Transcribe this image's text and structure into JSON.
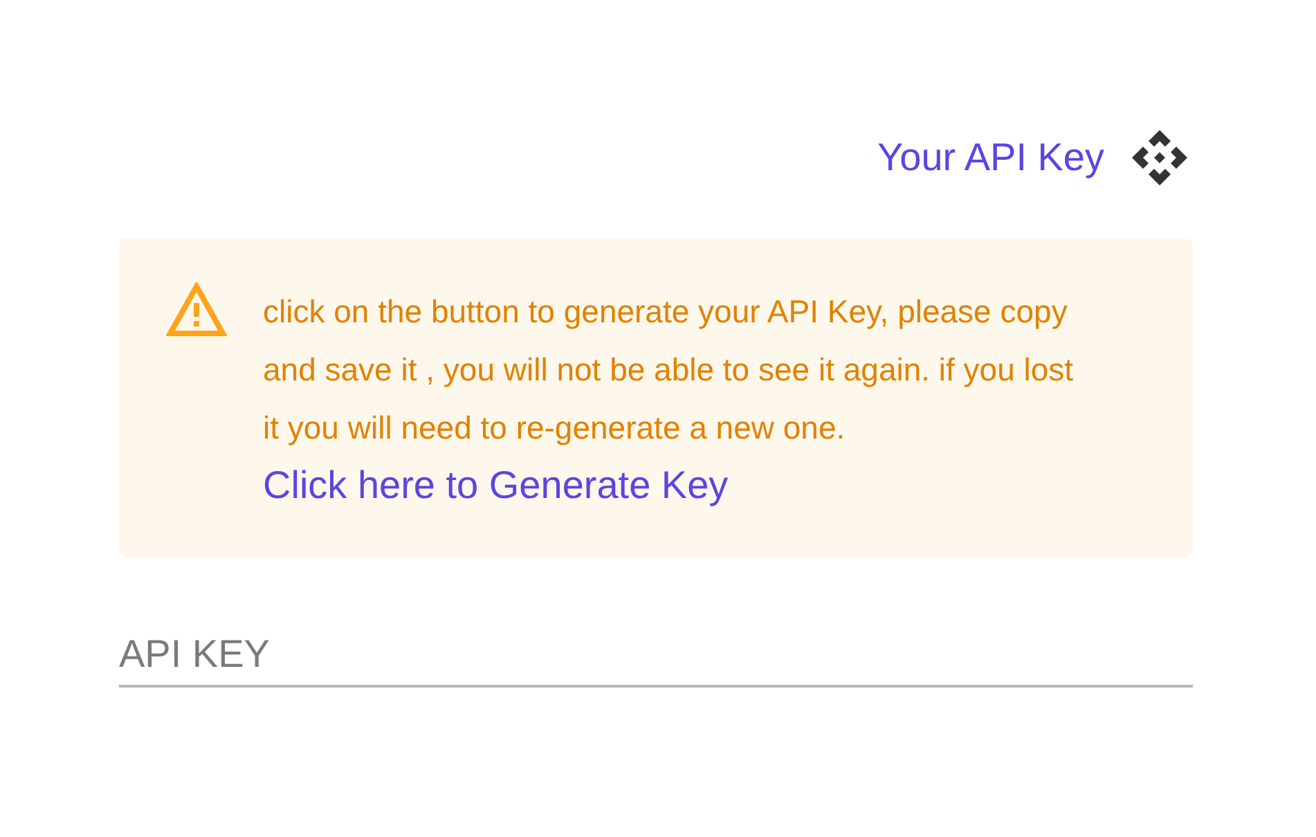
{
  "header": {
    "title": "Your API Key"
  },
  "alert": {
    "text": "click on the button to generate your API Key, please copy and save it , you will not be able to see it again. if you lost it you will need to re-generate a new one.",
    "link": "Click here to Generate Key"
  },
  "api_key_field": {
    "placeholder": "API KEY"
  }
}
